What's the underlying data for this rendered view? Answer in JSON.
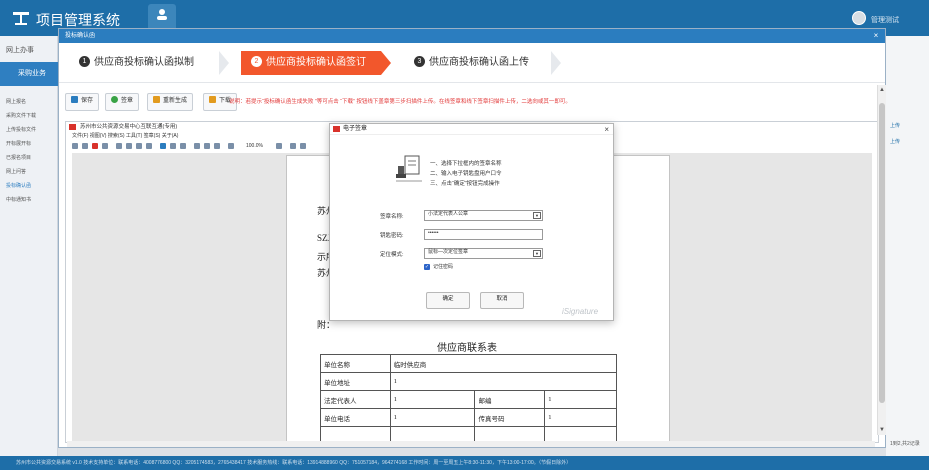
{
  "header": {
    "app_title": "项目管理系统",
    "user_name": "管理测试",
    "brand_color": "#1e6ea8"
  },
  "sidebar": {
    "top_label": "网上办事",
    "section_label": "采购业务",
    "items": [
      "网上报名",
      "采购文件下载",
      "上传投标文件",
      "开标展开标",
      "已报名项目",
      "网上问答",
      "投标确认函",
      "中标通知书"
    ]
  },
  "background": {
    "right_links": [
      "上传",
      "上传"
    ],
    "pager_text": "1到2,共2记录"
  },
  "footer": {
    "text": "苏州市公共资源交易系统 v1.0   技术支持单位：联系电话：4008776800 QQ：3205174583，2765438417 技术服务热线：联系电话：13914888960 QQ：751057184，964274168 工作时间：周一至周五上午8:30-11:30，下午13:00-17:00。（节假日除外）"
  },
  "modal": {
    "title": "投标确认函",
    "steps": [
      {
        "num": "1",
        "label": "供应商投标确认函拟制"
      },
      {
        "num": "2",
        "label": "供应商投标确认函签订"
      },
      {
        "num": "3",
        "label": "供应商投标确认函上传"
      }
    ],
    "active_step_color": "#f2572c",
    "toolbar": {
      "save": "保存",
      "sign": "签章",
      "regenerate": "重新生成",
      "download": "下载",
      "notice": "说明：若提示“投标确认函生成失败 ”等可点击 “下载” 按钮线下盖章第三步扫描件上传。在线签章和线下签章扫描件上传，二选向或其一即可。"
    }
  },
  "viewer": {
    "title": "苏州市公共资源交易中心互联互通(专用)",
    "menu": "文件(F)   视图(V)   搜索(S)   工具(T)   签章(S)   关于(A)",
    "zoom": "100.0%",
    "doc_lines": [
      "苏州",
      "SZJC",
      "示所",
      "苏州"
    ],
    "attachment_label": "附：",
    "contact_title": "供应商联系表",
    "table": [
      [
        "单位名称",
        "临时供应商",
        "",
        ""
      ],
      [
        "单位地址",
        "1",
        "",
        ""
      ],
      [
        "法定代表人",
        "1",
        "邮编",
        "1"
      ],
      [
        "单位电话",
        "1",
        "传真号码",
        "1"
      ],
      [
        "",
        "",
        "",
        ""
      ]
    ]
  },
  "signature_dialog": {
    "title": "电子签章",
    "instructions": [
      "一、选择下拉框内的签章名称",
      "二、输入电子钥匙盘用户口令",
      "三、点击“确定”按钮完成操作"
    ],
    "fields": {
      "seal_name_label": "签章名称:",
      "seal_name_value": "小法定代表人公章",
      "password_label": "钥匙密码:",
      "password_value": "••••••",
      "mode_label": "定位模式:",
      "mode_value": "鼠标—次定位签章"
    },
    "remember_label": "记住密码",
    "ok_label": "确定",
    "cancel_label": "取消",
    "watermark": "iSignature"
  }
}
